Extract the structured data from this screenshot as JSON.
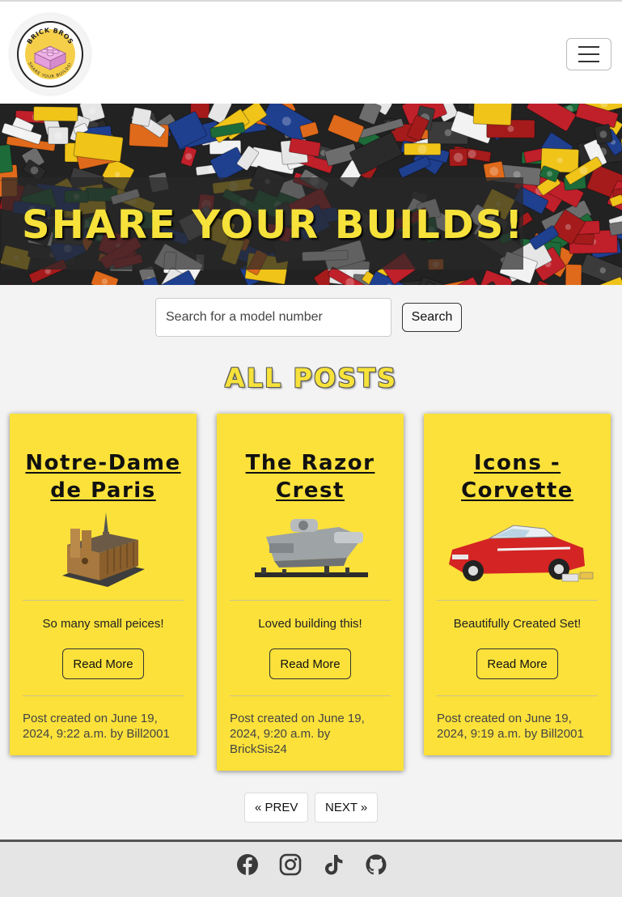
{
  "brand": {
    "logo_text_top": "BRICK BROS",
    "logo_text_bottom": "SHARE YOUR BUILDS!"
  },
  "hero": {
    "title": "SHARE YOUR BUILDS!"
  },
  "search": {
    "placeholder": "Search for a model number",
    "button_label": "Search"
  },
  "section": {
    "title": "ALL POSTS"
  },
  "posts": [
    {
      "title": "Notre-Dame de Paris",
      "description": "So many small peices!",
      "button_label": "Read More",
      "meta": "Post created on June 19, 2024, 9:22 a.m. by Bill2001"
    },
    {
      "title": "The Razor Crest",
      "description": "Loved building this!",
      "button_label": "Read More",
      "meta": "Post created on June 19, 2024, 9:20 a.m. by BrickSis24"
    },
    {
      "title": "Icons - Corvette",
      "description": "Beautifully Created Set!",
      "button_label": "Read More",
      "meta": "Post created on June 19, 2024, 9:19 a.m. by Bill2001"
    }
  ],
  "pagination": {
    "prev_label": "« PREV",
    "next_label": "NEXT »"
  },
  "footer": {
    "icons": [
      "facebook-icon",
      "instagram-icon",
      "tiktok-icon",
      "github-icon"
    ]
  },
  "colors": {
    "accent_yellow": "#fbe13a",
    "title_yellow": "#f6e23a",
    "footer_bg": "#e5e5e5"
  }
}
